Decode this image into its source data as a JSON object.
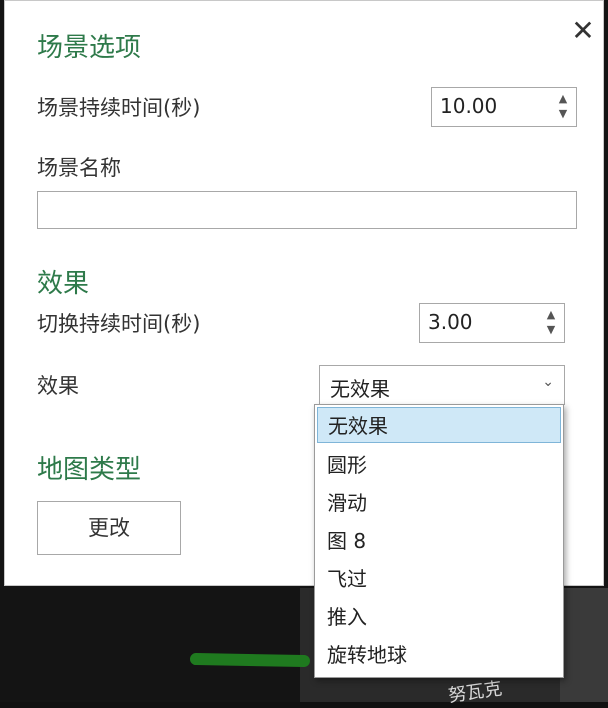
{
  "map": {
    "label": "努瓦克"
  },
  "dialog": {
    "close_glyph": "✕",
    "scene_options_heading": "场景选项",
    "scene_duration_label": "场景持续时间(秒)",
    "scene_duration_value": "10.00",
    "scene_name_label": "场景名称",
    "scene_name_value": "",
    "effect_heading": "效果",
    "transition_duration_label": "切换持续时间(秒)",
    "transition_duration_value": "3.00",
    "effect_label": "效果",
    "effect_selected": "无效果",
    "effect_options": [
      "无效果",
      "圆形",
      "滑动",
      "图 8",
      "飞过",
      "推入",
      "旋转地球"
    ],
    "map_type_heading": "地图类型",
    "change_button": "更改"
  },
  "icons": {
    "spin_up": "▲",
    "spin_down": "▼",
    "chevron": "⌄"
  }
}
